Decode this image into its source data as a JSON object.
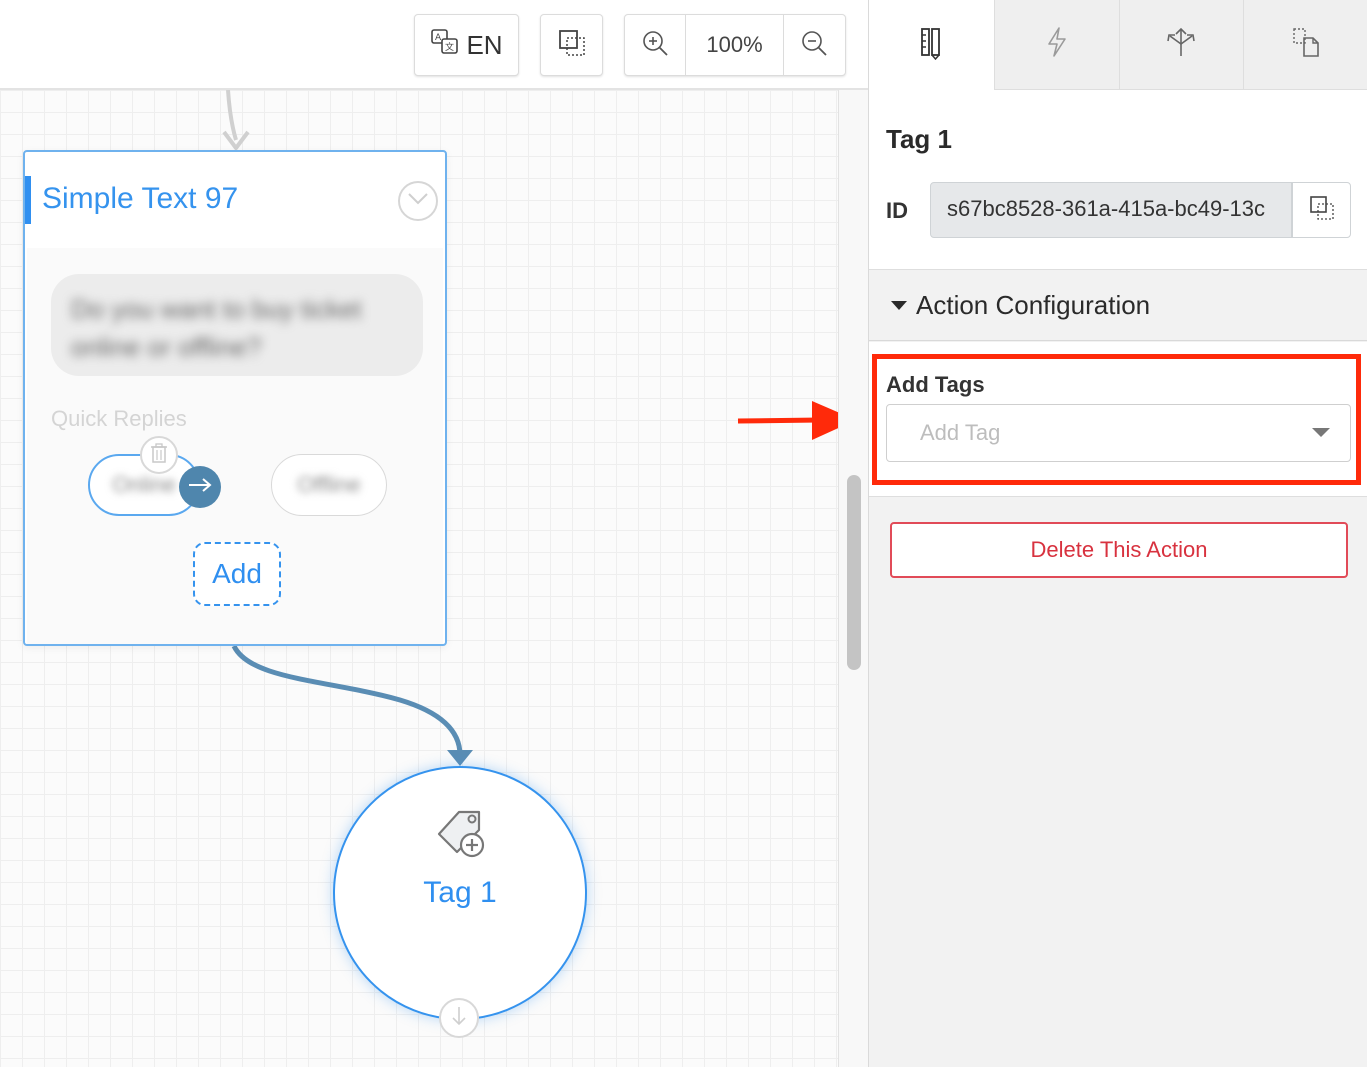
{
  "toolbar": {
    "language_label": "EN",
    "zoom_level": "100%"
  },
  "node": {
    "title": "Simple Text 97",
    "message": "Do you want to buy ticket online or offline?",
    "quick_replies_label": "Quick Replies",
    "replies": [
      "Online",
      "Offline"
    ],
    "add_label": "Add"
  },
  "tag_node": {
    "label": "Tag 1"
  },
  "panel": {
    "title": "Tag 1",
    "id_label": "ID",
    "id_value": "s67bc8528-361a-415a-bc49-13c",
    "section_title": "Action Configuration",
    "add_tags_label": "Add Tags",
    "add_tag_placeholder": "Add Tag",
    "delete_label": "Delete This Action"
  },
  "colors": {
    "accent_blue": "#3593ee",
    "connector": "#5a8db4",
    "highlight_red": "#ff2a0a",
    "delete_red": "#d8323f"
  },
  "icons": {
    "tabs": [
      "properties-icon",
      "lightning-icon",
      "branch-icon",
      "copy-flow-icon"
    ]
  }
}
